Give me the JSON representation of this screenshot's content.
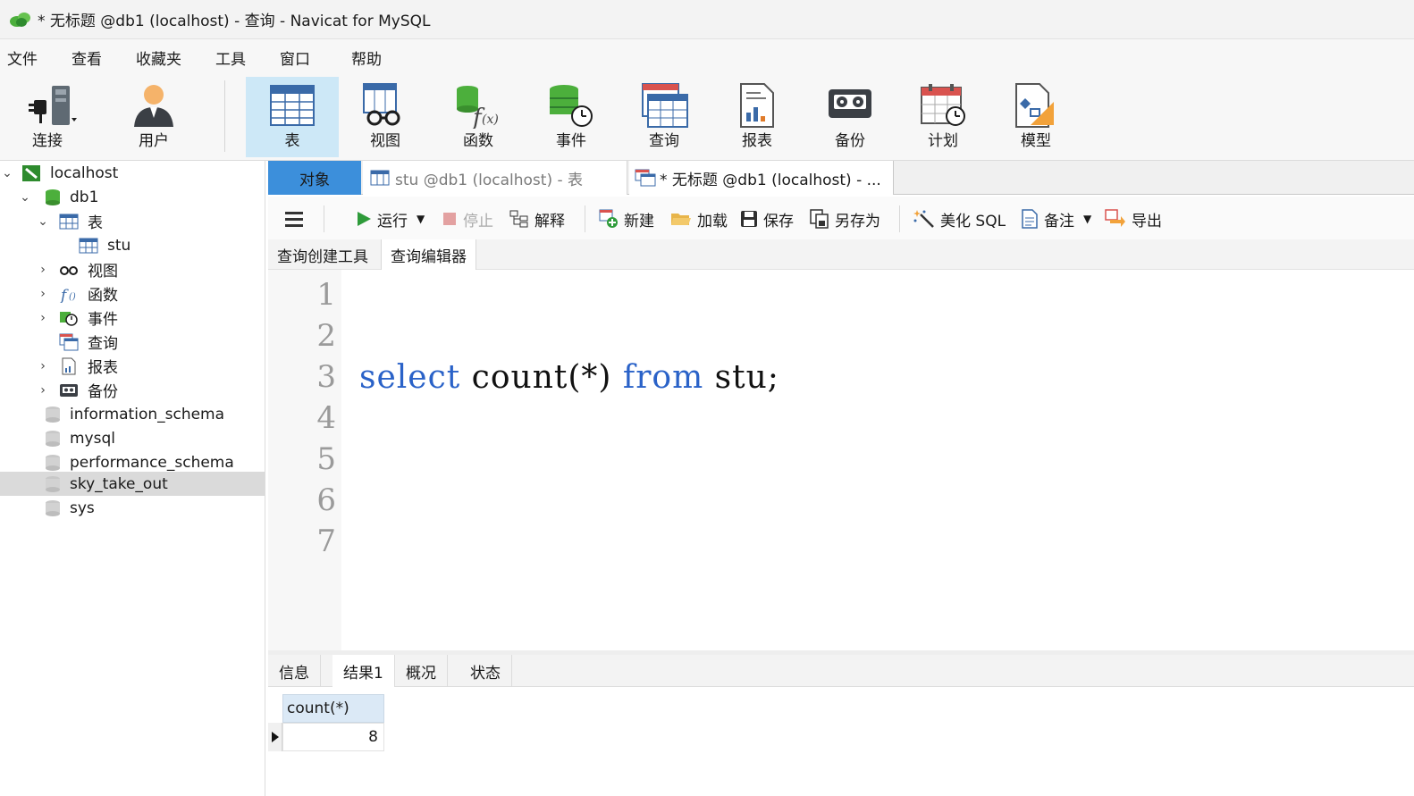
{
  "window": {
    "title": "* 无标题 @db1 (localhost) - 查询 - Navicat for MySQL"
  },
  "menu": [
    "文件",
    "查看",
    "收藏夹",
    "工具",
    "窗口",
    "帮助"
  ],
  "ribbon": {
    "connect": "连接",
    "user": "用户",
    "table": "表",
    "view": "视图",
    "function": "函数",
    "event": "事件",
    "query": "查询",
    "report": "报表",
    "backup": "备份",
    "schedule": "计划",
    "model": "模型"
  },
  "tree": {
    "connection": "localhost",
    "database": "db1",
    "tables_folder": "表",
    "table_stu": "stu",
    "views_folder": "视图",
    "functions_folder": "函数",
    "events_folder": "事件",
    "queries_folder": "查询",
    "reports_folder": "报表",
    "backups_folder": "备份",
    "other_databases": [
      "information_schema",
      "mysql",
      "performance_schema",
      "sky_take_out",
      "sys"
    ],
    "selected": "sky_take_out"
  },
  "tabs": {
    "objects": "对象",
    "stu_tab": "stu @db1 (localhost) - 表",
    "query_tab": "* 无标题 @db1 (localhost) - ..."
  },
  "query_toolbar": {
    "run": "运行",
    "stop": "停止",
    "explain": "解释",
    "new": "新建",
    "load": "加载",
    "save": "保存",
    "save_as": "另存为",
    "beautify": "美化 SQL",
    "comment": "备注",
    "export": "导出"
  },
  "sub_tabs": {
    "builder": "查询创建工具",
    "editor": "查询编辑器"
  },
  "editor": {
    "line_numbers": [
      "1",
      "2",
      "3",
      "4",
      "5",
      "6",
      "7"
    ],
    "code_kw1": "select",
    "code_mid": " count(*) ",
    "code_kw2": "from",
    "code_end": " stu;"
  },
  "result_tabs": {
    "info": "信息",
    "result1": "结果1",
    "overview": "概况",
    "status": "状态"
  },
  "result_grid": {
    "column": "count(*)",
    "value": "8"
  },
  "colors": {
    "active_tab": "#3c8fdb",
    "ribbon_active": "#cde8f7",
    "keyword": "#2a62c8"
  }
}
